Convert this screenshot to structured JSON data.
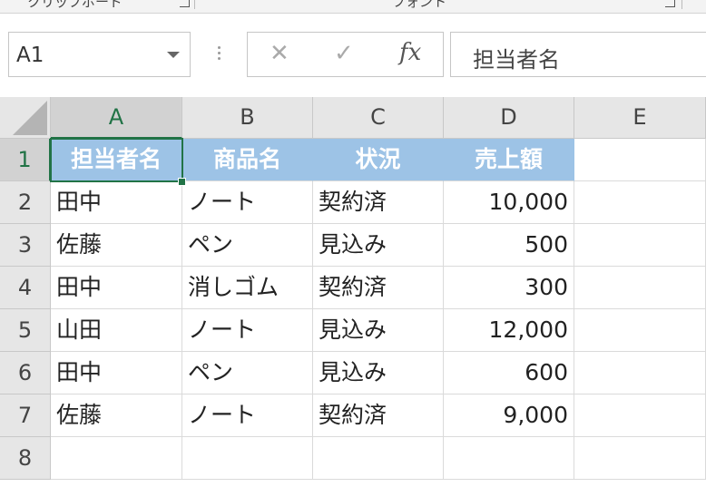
{
  "name_box": {
    "value": "A1"
  },
  "formula_bar": {
    "cancel_glyph": "✕",
    "enter_glyph": "✓",
    "fx_label": "fx",
    "content": "担当者名"
  },
  "grid": {
    "columns": [
      "A",
      "B",
      "C",
      "D",
      "E"
    ],
    "rows": [
      "1",
      "2",
      "3",
      "4",
      "5",
      "6",
      "7",
      "8"
    ],
    "header_row": [
      "担当者名",
      "商品名",
      "状況",
      "売上額"
    ],
    "data_rows": [
      [
        "田中",
        "ノート",
        "契約済",
        "10,000"
      ],
      [
        "佐藤",
        "ペン",
        "見込み",
        "500"
      ],
      [
        "田中",
        "消しゴム",
        "契約済",
        "300"
      ],
      [
        "山田",
        "ノート",
        "見込み",
        "12,000"
      ],
      [
        "田中",
        "ペン",
        "見込み",
        "600"
      ],
      [
        "佐藤",
        "ノート",
        "契約済",
        "9,000"
      ]
    ],
    "active_cell": "A1",
    "header_fill_color": "#9dc3e6",
    "selection_color": "#217346"
  }
}
